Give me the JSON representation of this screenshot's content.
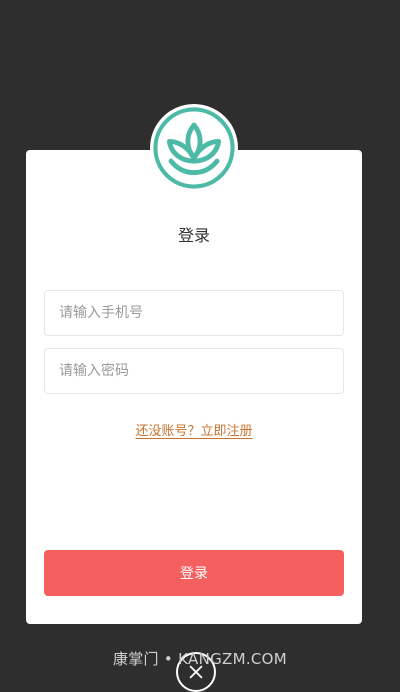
{
  "login_modal": {
    "title": "登录",
    "phone_placeholder": "请输入手机号",
    "password_placeholder": "请输入密码",
    "register_link": "还没账号？立即注册",
    "login_button": "登录"
  },
  "watermark": "康掌门 • KANGZM.COM",
  "colors": {
    "overlay": "#2e2e2e",
    "brand_teal": "#4dbaa8",
    "link": "#c8742c",
    "primary_button": "#f45f5f"
  },
  "icons": {
    "logo": "lotus-icon",
    "close": "close-icon"
  }
}
